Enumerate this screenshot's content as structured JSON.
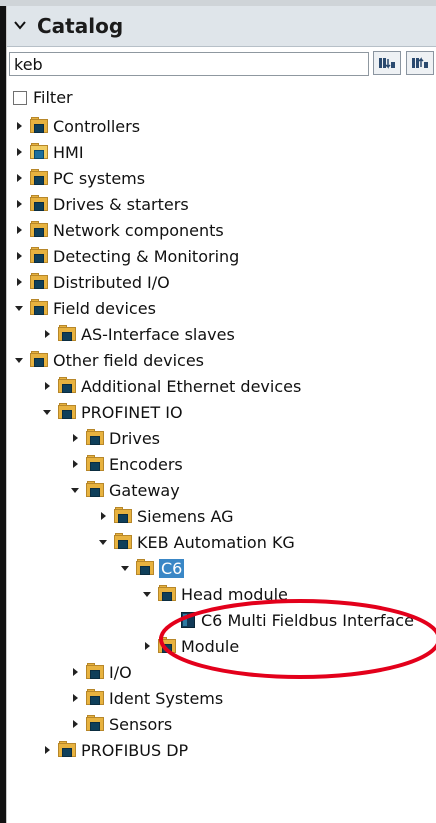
{
  "header": {
    "title": "Catalog"
  },
  "search": {
    "value": "keb",
    "placeholder": ""
  },
  "buttons": {
    "down_icon": "search-down-icon",
    "up_icon": "search-up-icon"
  },
  "filter": {
    "label": "Filter"
  },
  "tree": {
    "items": [
      {
        "label": "Controllers"
      },
      {
        "label": "HMI"
      },
      {
        "label": "PC systems"
      },
      {
        "label": "Drives & starters"
      },
      {
        "label": "Network components"
      },
      {
        "label": "Detecting & Monitoring"
      },
      {
        "label": "Distributed I/O"
      },
      {
        "label": "Field devices"
      },
      {
        "label": "AS-Interface slaves"
      },
      {
        "label": "Other field devices"
      },
      {
        "label": "Additional Ethernet devices"
      },
      {
        "label": "PROFINET IO"
      },
      {
        "label": "Drives"
      },
      {
        "label": "Encoders"
      },
      {
        "label": "Gateway"
      },
      {
        "label": "Siemens AG"
      },
      {
        "label": "KEB Automation KG"
      },
      {
        "label": "C6"
      },
      {
        "label": "Head module"
      },
      {
        "label": "C6 Multi Fieldbus Interface"
      },
      {
        "label": "Module"
      },
      {
        "label": "I/O"
      },
      {
        "label": "Ident Systems"
      },
      {
        "label": "Sensors"
      },
      {
        "label": "PROFIBUS DP"
      }
    ]
  },
  "colors": {
    "annotation": "#e3001b",
    "selection": "#3a87c6",
    "folder": "#e7b23f"
  }
}
